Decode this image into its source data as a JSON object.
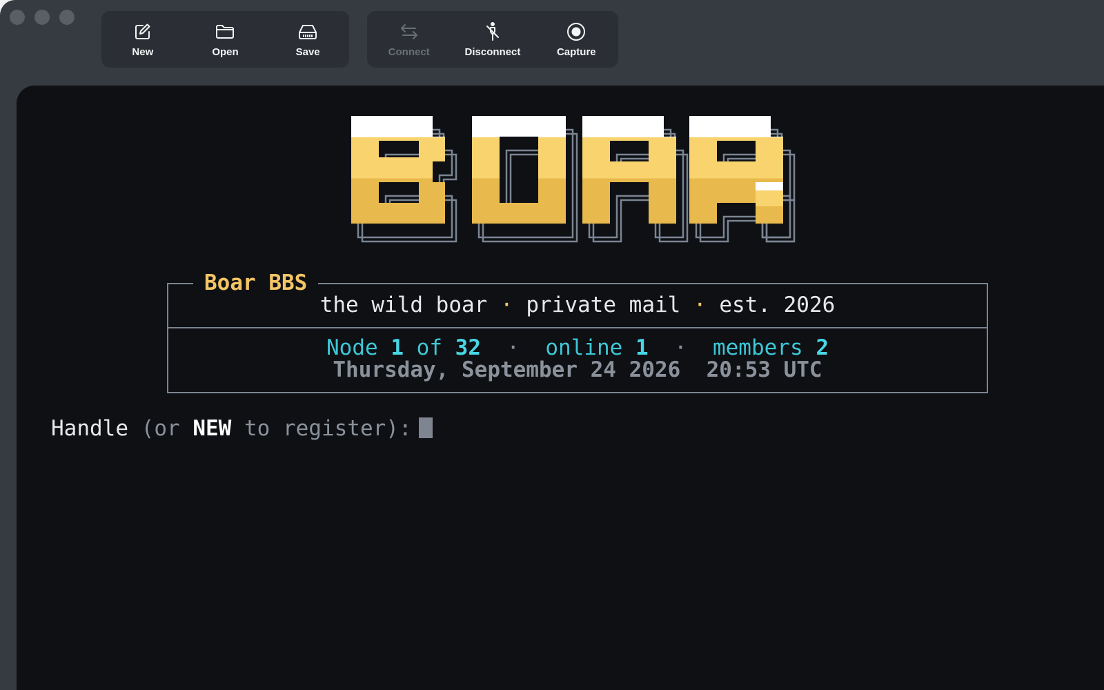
{
  "toolbar": {
    "new_label": "New",
    "open_label": "Open",
    "save_label": "Save",
    "connect_label": "Connect",
    "disconnect_label": "Disconnect",
    "capture_label": "Capture"
  },
  "terminal": {
    "logo_text": "BOAR",
    "box": {
      "title": "Boar BBS",
      "tag_part1": "the wild boar",
      "tag_sep": "·",
      "tag_part2": "private mail",
      "tag_part3": "est. 2026",
      "node_label": "Node",
      "node_number": "1",
      "of_label": "of",
      "node_total": "32",
      "stats_sep": "·",
      "online_label": "online",
      "online_count": "1",
      "members_label": "members",
      "members_count": "2",
      "date": "Thursday, September 24 2026",
      "time": "20:53 UTC"
    },
    "prompt": {
      "label": "Handle",
      "paren_open": "(or",
      "keyword": "NEW",
      "paren_rest": "to register):"
    }
  },
  "colors": {
    "logo_top": "#ffffff",
    "logo_gold_light": "#f8d36e",
    "logo_gold_dark": "#e8b94c",
    "accent_gold": "#f3c565",
    "accent_cyan": "#3ec7d6",
    "border": "#7b8491",
    "terminal_bg": "#0e1014"
  }
}
